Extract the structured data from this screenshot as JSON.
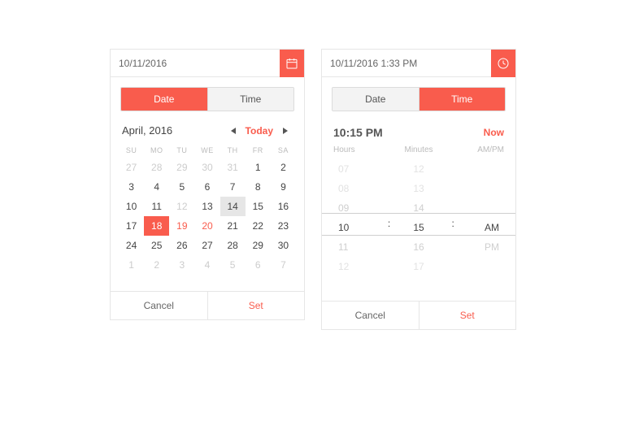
{
  "datePicker": {
    "headerValue": "10/11/2016",
    "tabs": {
      "date": "Date",
      "time": "Time"
    },
    "month": "April, 2016",
    "todayLabel": "Today",
    "weekdays": [
      "SU",
      "MO",
      "TU",
      "WE",
      "TH",
      "FR",
      "SA"
    ],
    "rows": [
      [
        {
          "n": "27",
          "dim": true
        },
        {
          "n": "28",
          "dim": true
        },
        {
          "n": "29",
          "dim": true
        },
        {
          "n": "30",
          "dim": true
        },
        {
          "n": "31",
          "dim": true
        },
        {
          "n": "1"
        },
        {
          "n": "2"
        }
      ],
      [
        {
          "n": "3"
        },
        {
          "n": "4"
        },
        {
          "n": "5"
        },
        {
          "n": "6"
        },
        {
          "n": "7"
        },
        {
          "n": "8"
        },
        {
          "n": "9"
        }
      ],
      [
        {
          "n": "10"
        },
        {
          "n": "11"
        },
        {
          "n": "12",
          "dim": true
        },
        {
          "n": "13"
        },
        {
          "n": "14",
          "hover": true
        },
        {
          "n": "15"
        },
        {
          "n": "16"
        }
      ],
      [
        {
          "n": "17"
        },
        {
          "n": "18",
          "selected": true
        },
        {
          "n": "19",
          "red": true
        },
        {
          "n": "20",
          "red": true
        },
        {
          "n": "21"
        },
        {
          "n": "22"
        },
        {
          "n": "23"
        }
      ],
      [
        {
          "n": "24"
        },
        {
          "n": "25"
        },
        {
          "n": "26"
        },
        {
          "n": "27"
        },
        {
          "n": "28"
        },
        {
          "n": "29"
        },
        {
          "n": "30"
        }
      ],
      [
        {
          "n": "1",
          "dim": true
        },
        {
          "n": "2",
          "dim": true
        },
        {
          "n": "3",
          "dim": true
        },
        {
          "n": "4",
          "dim": true
        },
        {
          "n": "5",
          "dim": true
        },
        {
          "n": "6",
          "dim": true
        },
        {
          "n": "7",
          "dim": true
        }
      ]
    ],
    "cancel": "Cancel",
    "set": "Set"
  },
  "timePicker": {
    "headerValue": "10/11/2016 1:33 PM",
    "tabs": {
      "date": "Date",
      "time": "Time"
    },
    "currentTime": "10:15 PM",
    "nowLabel": "Now",
    "cols": {
      "hours": "Hours",
      "minutes": "Minutes",
      "ampm": "AM/PM"
    },
    "hours": [
      "07",
      "08",
      "09",
      "10",
      "11",
      "12"
    ],
    "minutes": [
      "12",
      "13",
      "14",
      "15",
      "16",
      "17"
    ],
    "ampm": [
      "AM",
      "PM"
    ],
    "cancel": "Cancel",
    "set": "Set"
  }
}
